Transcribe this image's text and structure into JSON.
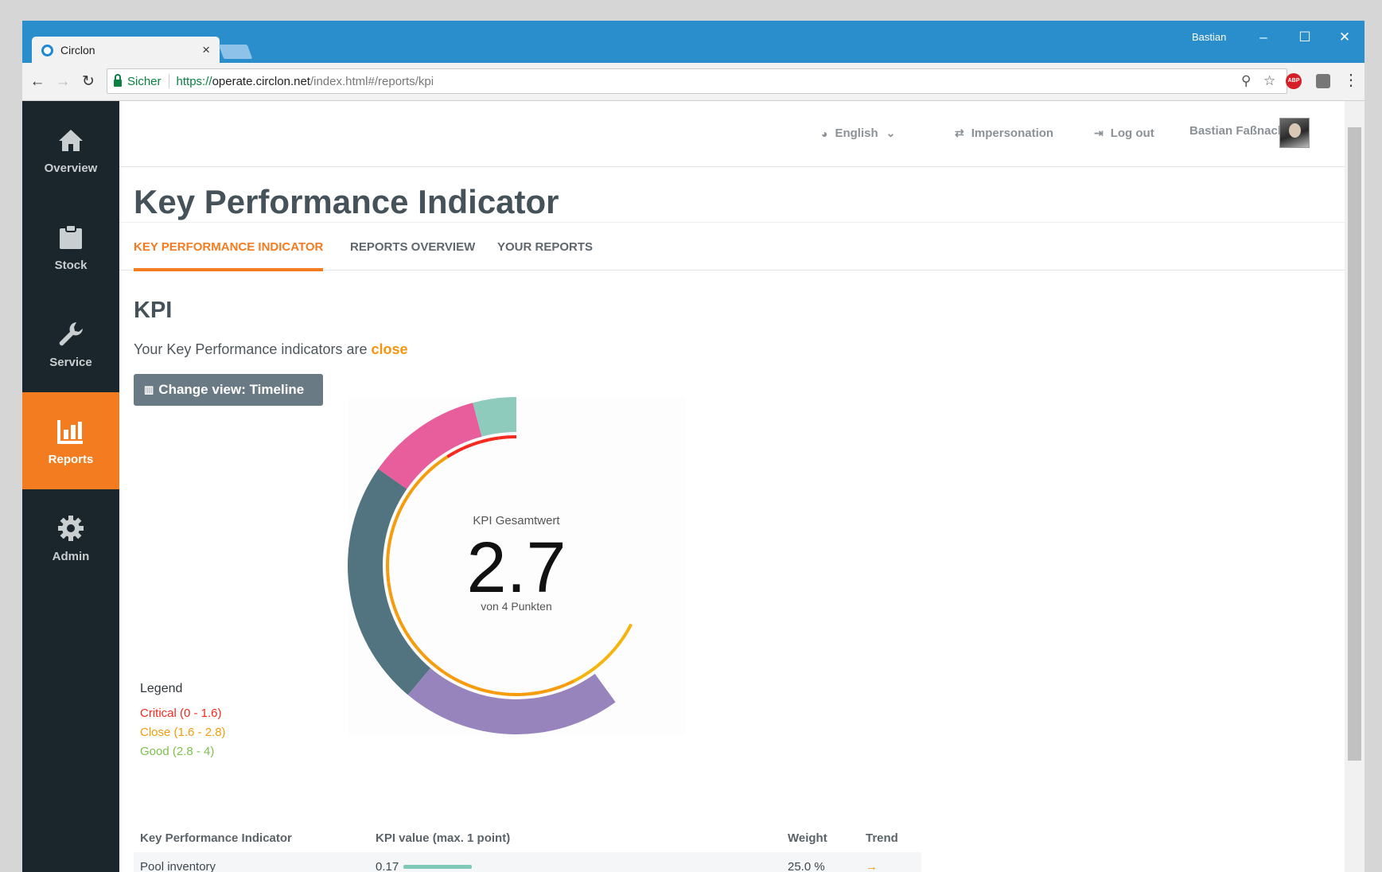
{
  "browser": {
    "tab_title": "Circlon",
    "user": "Bastian",
    "secure_label": "Sicher",
    "url_proto": "https://",
    "url_host": "operate.circlon.net",
    "url_path": "/index.html#/reports/kpi",
    "abp": "ABP"
  },
  "sidebar": {
    "items": [
      {
        "label": "Overview",
        "icon": "home-icon"
      },
      {
        "label": "Stock",
        "icon": "clipboard-icon"
      },
      {
        "label": "Service",
        "icon": "wrench-icon"
      },
      {
        "label": "Reports",
        "icon": "bar-chart-icon",
        "active": true
      },
      {
        "label": "Admin",
        "icon": "gear-icon"
      }
    ]
  },
  "topbar": {
    "language": "English",
    "impersonation": "Impersonation",
    "logout": "Log out",
    "user_name": "Bastian Faßnacht"
  },
  "page": {
    "title": "Key Performance Indicator",
    "tabs": [
      "KEY PERFORMANCE INDICATOR",
      "REPORTS OVERVIEW",
      "YOUR REPORTS"
    ],
    "section_title": "KPI",
    "status_prefix": "Your Key Performance indicators are",
    "status_value": "close",
    "change_view_button": "Change view: Timeline"
  },
  "chart_data": {
    "type": "pie",
    "center_label": "KPI Gesamtwert",
    "value": 2.7,
    "value_text": "2.7",
    "value_suffix": "von 4 Punkten",
    "max": 4,
    "segments": [
      {
        "color": "#8ecbbc",
        "value": 0.0417
      },
      {
        "color": "#e85d9b",
        "value": 0.1111
      },
      {
        "color": "#527380",
        "value": 0.2361
      },
      {
        "color": "#9784bd",
        "value": 0.2111
      }
    ],
    "gauge_colors": [
      "#f52a1f",
      "#f59b0c",
      "#f5b40c"
    ],
    "legend_title": "Legend",
    "legend": [
      {
        "label": "Critical (0 - 1.6)",
        "color": "#f52a1f"
      },
      {
        "label": "Close (1.6 - 2.8)",
        "color": "#f59b0c"
      },
      {
        "label": "Good (2.8 - 4)",
        "color": "#7cc04f"
      }
    ]
  },
  "table": {
    "headers": [
      "Key Performance Indicator",
      "KPI value (max. 1 point)",
      "Weight",
      "Trend"
    ],
    "rows": [
      {
        "name": "Pool inventory",
        "value": "0.17",
        "bar_fraction": 0.17,
        "weight": "25.0 %",
        "trend": "→"
      }
    ]
  }
}
